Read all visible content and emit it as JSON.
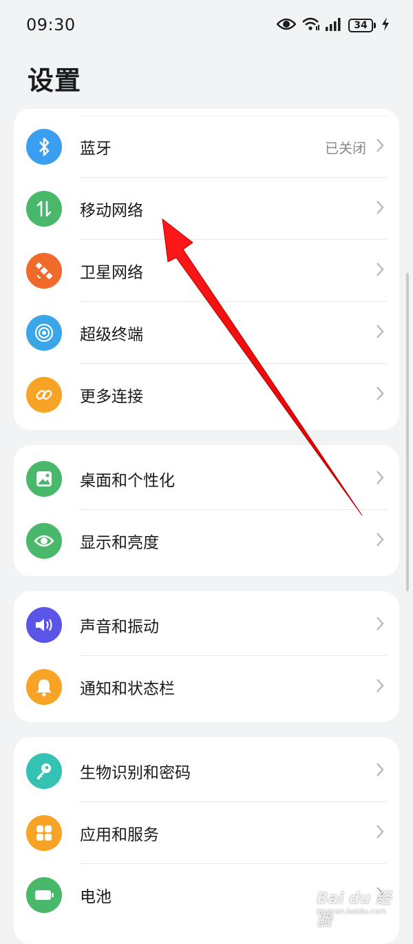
{
  "status_bar": {
    "time": "09:30",
    "battery": "34",
    "icons": [
      "eye-icon",
      "wifi-icon",
      "signal-icon",
      "battery-icon",
      "charging-icon"
    ]
  },
  "page": {
    "title": "设置"
  },
  "groups": [
    {
      "items": [
        {
          "label": "蓝牙",
          "value": "已关闭",
          "icon": "bluetooth-icon",
          "color": "#3a9ff1"
        },
        {
          "label": "移动网络",
          "icon": "mobile-data-icon",
          "color": "#4ab86a"
        },
        {
          "label": "卫星网络",
          "icon": "satellite-icon",
          "color": "#f06a2b"
        },
        {
          "label": "超级终端",
          "icon": "super-device-icon",
          "color": "#3aa6e8"
        },
        {
          "label": "更多连接",
          "icon": "link-icon",
          "color": "#f7a325"
        }
      ]
    },
    {
      "items": [
        {
          "label": "桌面和个性化",
          "icon": "wallpaper-icon",
          "color": "#4ab86a"
        },
        {
          "label": "显示和亮度",
          "icon": "eye-icon",
          "color": "#4ab86a"
        }
      ]
    },
    {
      "items": [
        {
          "label": "声音和振动",
          "icon": "speaker-icon",
          "color": "#5a55e6"
        },
        {
          "label": "通知和状态栏",
          "icon": "bell-icon",
          "color": "#f7a325"
        }
      ]
    },
    {
      "items": [
        {
          "label": "生物识别和密码",
          "icon": "key-icon",
          "color": "#34c2b4"
        },
        {
          "label": "应用和服务",
          "icon": "apps-icon",
          "color": "#f7a325"
        },
        {
          "label": "电池",
          "icon": "battery-icon",
          "color": "#4ab86a"
        }
      ]
    }
  ],
  "watermark": {
    "text": "Bai du 经验",
    "sub": "jingyan.baidu.com"
  }
}
